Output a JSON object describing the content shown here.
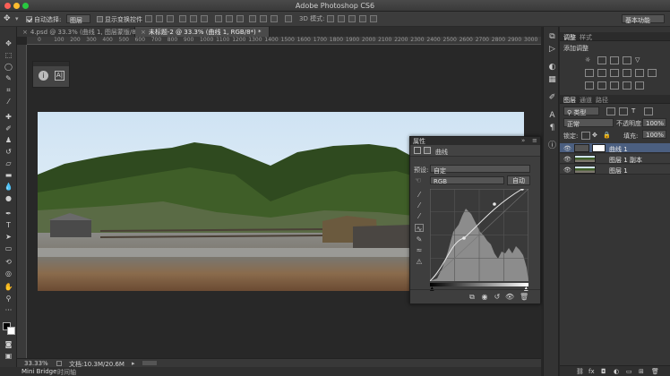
{
  "app": {
    "title": "Adobe Photoshop CS6",
    "workspace": "基本功能"
  },
  "options_bar": {
    "auto_select_label": "自动选择:",
    "auto_select_target": "图层",
    "show_transform_label": "显示变换控件"
  },
  "tabs": [
    {
      "label": "4.psd @ 33.3% (曲线 1, 图层蒙版/8) *",
      "active": false
    },
    {
      "label": "未标题-2 @ 33.3% (曲线 1, RGB/8*) *",
      "active": true
    }
  ],
  "ruler_ticks": [
    "0",
    "100",
    "200",
    "300",
    "400",
    "500",
    "600",
    "700",
    "800",
    "900",
    "1000",
    "1100",
    "1200",
    "1300",
    "1400",
    "1500",
    "1600",
    "1700",
    "1800",
    "1900",
    "2000",
    "2100",
    "2200",
    "2300",
    "2400",
    "2500",
    "2600",
    "2700",
    "2800",
    "2900",
    "3000"
  ],
  "status": {
    "zoom": "33.33%",
    "doc": "文档:10.3M/20.6M"
  },
  "bottom_tabs": [
    "Mini Bridge",
    "时间轴"
  ],
  "properties": {
    "title": "属性",
    "section": "曲线",
    "preset_label": "预设:",
    "preset_value": "自定",
    "channel_value": "RGB",
    "auto_label": "自动"
  },
  "panel_adjust": {
    "tabs": [
      "调整",
      "样式"
    ],
    "add_label": "添加调整"
  },
  "panel_layers": {
    "tabs": [
      "图层",
      "通道",
      "路径"
    ],
    "filter_kind": "类型",
    "blend_mode": "正常",
    "opacity_label": "不透明度:",
    "opacity_value": "100%",
    "lock_label": "锁定:",
    "fill_label": "填充:",
    "fill_value": "100%",
    "layers": [
      {
        "name": "曲线 1",
        "selected": true
      },
      {
        "name": "图层 1 副本",
        "selected": false
      },
      {
        "name": "图层 1",
        "selected": false
      }
    ]
  },
  "colors": {
    "accent_selection": "#4b5f80",
    "chrome_dark": "#262626",
    "panel_bg": "#353535"
  }
}
